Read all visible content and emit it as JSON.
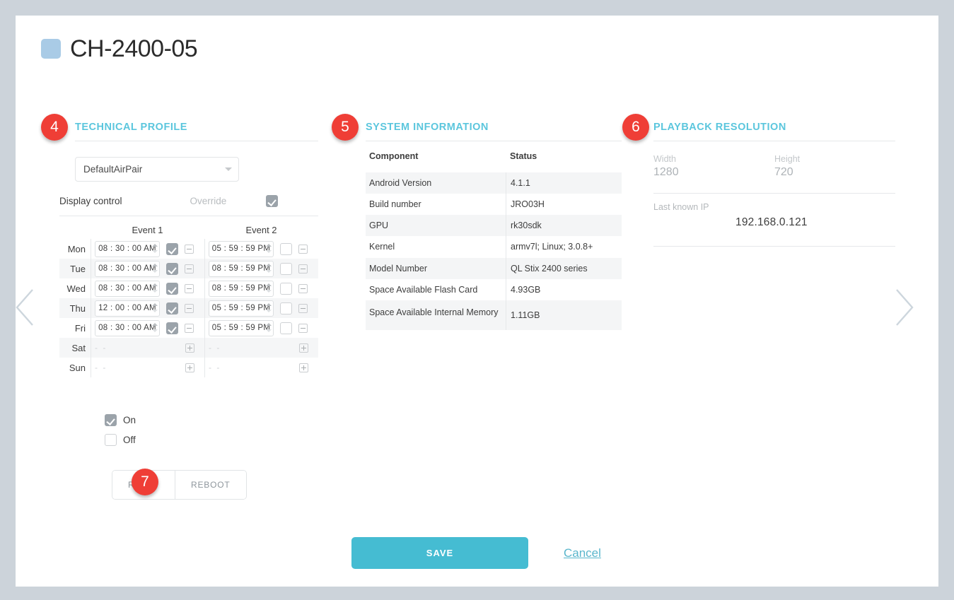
{
  "window": {
    "background_color": "#ccd3da",
    "card_color": "#ffffff"
  },
  "header": {
    "swatch_icon": "square-swatch-icon",
    "swatch_color": "#a9cbe6",
    "title": "CH-2400-05"
  },
  "nav": {
    "prev_icon": "chevron-left-icon",
    "next_icon": "chevron-right-icon",
    "arrow_color": "#cdd6dd"
  },
  "badges": [
    {
      "number": "4",
      "target": "technical-profile"
    },
    {
      "number": "5",
      "target": "system-information"
    },
    {
      "number": "6",
      "target": "playback-resolution"
    },
    {
      "number": "7",
      "target": "reset-reboot-buttons"
    }
  ],
  "badge_color": "#ef3e36",
  "accent_color": "#5bc6dd",
  "technical_profile": {
    "section_title": "TECHNICAL PROFILE",
    "profile_select": {
      "value": "DefaultAirPair",
      "caret_icon": "chevron-down-icon"
    },
    "display_control": {
      "label": "Display control",
      "override_label": "Override",
      "override_checked": true
    },
    "schedule": {
      "columns": [
        "Event 1",
        "Event 2"
      ],
      "rows": [
        {
          "day": "Mon",
          "event1": {
            "time": "08 : 30 : 00 AM",
            "enabled": true,
            "action_icon": "minus-box-icon"
          },
          "event2": {
            "time": "05 : 59 : 59 PM",
            "enabled": false,
            "action_icon": "minus-box-icon"
          }
        },
        {
          "day": "Tue",
          "event1": {
            "time": "08 : 30 : 00 AM",
            "enabled": true,
            "action_icon": "minus-box-icon"
          },
          "event2": {
            "time": "08 : 59 : 59 PM",
            "enabled": false,
            "action_icon": "minus-box-icon"
          }
        },
        {
          "day": "Wed",
          "event1": {
            "time": "08 : 30 : 00 AM",
            "enabled": true,
            "action_icon": "minus-box-icon"
          },
          "event2": {
            "time": "08 : 59 : 59 PM",
            "enabled": false,
            "action_icon": "minus-box-icon"
          }
        },
        {
          "day": "Thu",
          "event1": {
            "time": "12 : 00 : 00 AM",
            "enabled": true,
            "action_icon": "minus-box-icon"
          },
          "event2": {
            "time": "05 : 59 : 59 PM",
            "enabled": false,
            "action_icon": "minus-box-icon"
          }
        },
        {
          "day": "Fri",
          "event1": {
            "time": "08 : 30 : 00 AM",
            "enabled": true,
            "action_icon": "minus-box-icon"
          },
          "event2": {
            "time": "05 : 59 : 59 PM",
            "enabled": false,
            "action_icon": "minus-box-icon"
          }
        },
        {
          "day": "Sat",
          "event1": {
            "time": "- -",
            "empty": true,
            "action_icon": "plus-box-icon"
          },
          "event2": {
            "time": "- -",
            "empty": true,
            "action_icon": "plus-box-icon"
          }
        },
        {
          "day": "Sun",
          "event1": {
            "time": "- -",
            "empty": true,
            "action_icon": "plus-box-icon"
          },
          "event2": {
            "time": "- -",
            "empty": true,
            "action_icon": "plus-box-icon"
          }
        }
      ]
    },
    "power_options": [
      {
        "label": "On",
        "checked": true
      },
      {
        "label": "Off",
        "checked": false
      }
    ],
    "reset_label": "RESET",
    "reboot_label": "REBOOT"
  },
  "system_information": {
    "section_title": "SYSTEM INFORMATION",
    "headers": [
      "Component",
      "Status"
    ],
    "rows": [
      [
        "Android Version",
        "4.1.1"
      ],
      [
        "Build number",
        "JRO03H"
      ],
      [
        "GPU",
        "rk30sdk"
      ],
      [
        "Kernel",
        "armv7l; Linux; 3.0.8+"
      ],
      [
        "Model Number",
        "QL Stix 2400 series"
      ],
      [
        "Space Available Flash Card",
        "4.93GB"
      ],
      [
        "Space Available Internal Memory",
        "1.11GB"
      ]
    ]
  },
  "playback_resolution": {
    "section_title": "PLAYBACK RESOLUTION",
    "width_label": "Width",
    "width_value": "1280",
    "height_label": "Height",
    "height_value": "720",
    "ip_label": "Last known IP",
    "ip_value": "192.168.0.121"
  },
  "footer": {
    "save_label": "SAVE",
    "cancel_label": "Cancel",
    "save_color": "#45bcd2"
  }
}
